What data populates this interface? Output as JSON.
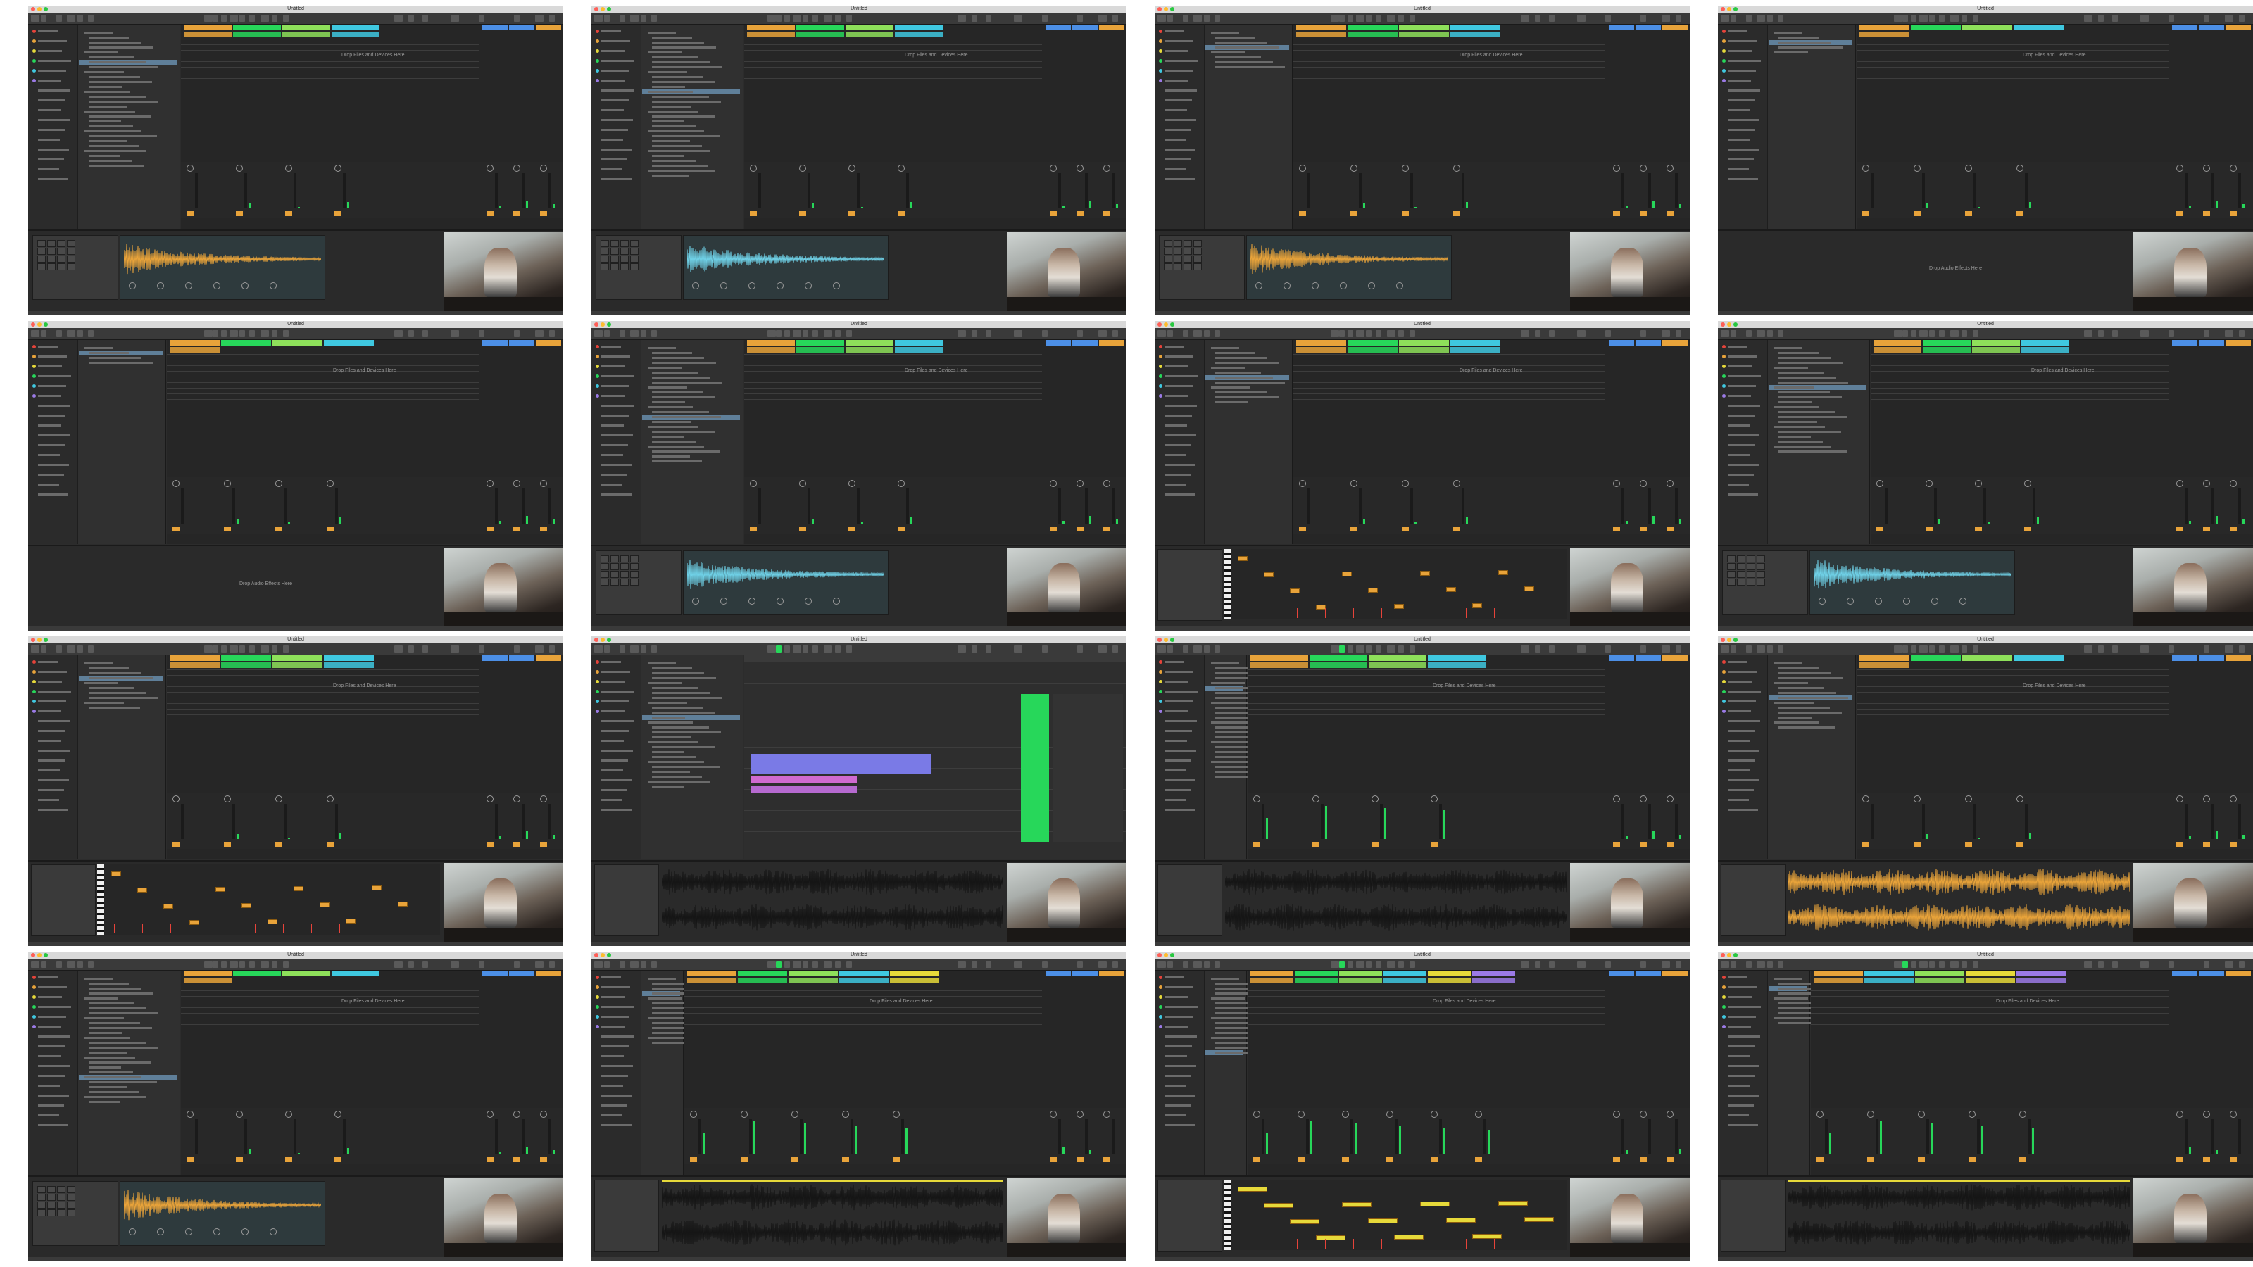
{
  "app": {
    "window_title": "Untitled",
    "drop_files_text": "Drop Files and Devices Here",
    "drop_effects_text": "Drop Audio Effects Here"
  },
  "colors": {
    "track_orange": "#e8a33a",
    "track_green": "#27d75a",
    "track_lime": "#8ee05a",
    "track_cyan": "#3fc8e0",
    "track_blue": "#4c8fe6",
    "track_yellow": "#e6d93a",
    "track_pink": "#e07aa6",
    "track_purple": "#9b7ae6",
    "meter_green": "#27d75a",
    "wave_orange": "#e8a33a",
    "wave_cyan": "#6fd0e6",
    "arrange_purple": "#7a7ae6",
    "arrange_magenta": "#d06ad0",
    "panel_dark": "#2c2c2c",
    "browser_sel": "#5f7f99"
  },
  "frames": [
    {
      "id": 1,
      "layout": "session-sampler",
      "tracks": [
        "orange",
        "green",
        "lime",
        "cyan"
      ],
      "detail": "drum-sampler",
      "browser_rows": 28,
      "selected_row": 6
    },
    {
      "id": 2,
      "layout": "session-sampler",
      "tracks": [
        "orange",
        "green",
        "lime",
        "cyan"
      ],
      "detail": "drum-sampler",
      "browser_rows": 30,
      "selected_row": 12
    },
    {
      "id": 3,
      "layout": "session-sampler",
      "tracks": [
        "orange",
        "green",
        "lime",
        "cyan"
      ],
      "detail": "drum-sampler",
      "browser_rows": 8,
      "selected_row": 3
    },
    {
      "id": 4,
      "layout": "session-empty",
      "tracks": [
        "orange",
        "green",
        "lime",
        "cyan"
      ],
      "detail": "empty",
      "browser_rows": 5,
      "selected_row": 2
    },
    {
      "id": 5,
      "layout": "session-empty",
      "tracks": [
        "orange",
        "green",
        "lime",
        "cyan"
      ],
      "detail": "empty",
      "browser_rows": 4,
      "selected_row": 1
    },
    {
      "id": 6,
      "layout": "session-sampler",
      "tracks": [
        "orange",
        "green",
        "lime",
        "cyan"
      ],
      "detail": "drum-sampler",
      "browser_rows": 24,
      "selected_row": 14
    },
    {
      "id": 7,
      "layout": "session-midi",
      "tracks": [
        "orange",
        "green",
        "lime",
        "cyan"
      ],
      "detail": "piano-roll",
      "browser_rows": 12,
      "selected_row": 6
    },
    {
      "id": 8,
      "layout": "session-sampler",
      "tracks": [
        "orange",
        "green",
        "lime",
        "cyan"
      ],
      "detail": "drum-sampler",
      "browser_rows": 22,
      "selected_row": 8
    },
    {
      "id": 9,
      "layout": "session-midi",
      "tracks": [
        "orange",
        "green",
        "lime",
        "cyan"
      ],
      "detail": "piano-roll",
      "browser_rows": 10,
      "selected_row": 3
    },
    {
      "id": 10,
      "layout": "arrangement",
      "tracks": [
        "purple",
        "magenta",
        "green"
      ],
      "detail": "audio-clip",
      "browser_rows": 26,
      "selected_row": 11
    },
    {
      "id": 11,
      "layout": "session-wide",
      "tracks": [
        "orange",
        "green",
        "lime",
        "cyan"
      ],
      "detail": "audio-clip",
      "browser_rows": 24,
      "selected_row": 5
    },
    {
      "id": 12,
      "layout": "session-empty",
      "tracks": [
        "orange",
        "green",
        "lime",
        "cyan"
      ],
      "detail": "audio-warp",
      "browser_rows": 14,
      "selected_row": 7
    },
    {
      "id": 13,
      "layout": "session-empty",
      "tracks": [
        "orange",
        "green",
        "lime",
        "cyan"
      ],
      "detail": "drum-sampler",
      "browser_rows": 26,
      "selected_row": 20
    },
    {
      "id": 14,
      "layout": "session-wide",
      "tracks": [
        "orange",
        "green",
        "lime",
        "cyan",
        "yellow"
      ],
      "detail": "audio-clip-yellow",
      "browser_rows": 14,
      "selected_row": 3
    },
    {
      "id": 15,
      "layout": "session-wide",
      "tracks": [
        "orange",
        "green",
        "lime",
        "cyan",
        "yellow",
        "purple"
      ],
      "detail": "piano-roll-yellow",
      "browser_rows": 16,
      "selected_row": 15
    },
    {
      "id": 16,
      "layout": "session-wide",
      "tracks": [
        "orange",
        "cyan",
        "lime",
        "yellow",
        "purple"
      ],
      "detail": "audio-clip-yellow",
      "browser_rows": 10,
      "selected_row": 2
    }
  ]
}
